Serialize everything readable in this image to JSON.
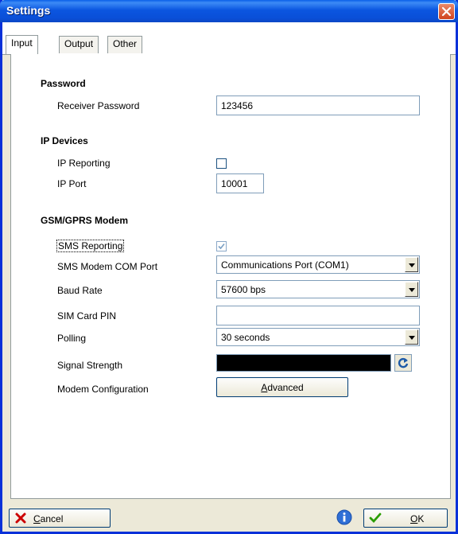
{
  "window": {
    "title": "Settings"
  },
  "tabs": [
    {
      "label": "Input",
      "active": true
    },
    {
      "label": "Output",
      "active": false
    },
    {
      "label": "Other",
      "active": false
    }
  ],
  "password": {
    "section_title": "Password",
    "receiver_password_label": "Receiver Password",
    "receiver_password_value": "123456"
  },
  "ip_devices": {
    "section_title": "IP Devices",
    "ip_reporting_label": "IP Reporting",
    "ip_reporting_checked": false,
    "ip_port_label": "IP Port",
    "ip_port_value": "10001"
  },
  "gsm": {
    "section_title": "GSM/GPRS Modem",
    "sms_reporting_label": "SMS Reporting",
    "sms_reporting_checked": true,
    "com_port_label": "SMS Modem COM Port",
    "com_port_value": "Communications Port (COM1)",
    "baud_rate_label": "Baud Rate",
    "baud_rate_value": "57600 bps",
    "sim_pin_label": "SIM Card PIN",
    "sim_pin_value": "",
    "polling_label": "Polling",
    "polling_value": "30 seconds",
    "signal_strength_label": "Signal Strength",
    "modem_config_label": "Modem Configuration",
    "advanced_button_label": "Advanced"
  },
  "footer": {
    "cancel_label": "Cancel",
    "ok_label": "OK"
  },
  "colors": {
    "title_bar": "#0a4fd8",
    "dialog_face": "#ece9d8",
    "cancel_icon": "#cc0000",
    "ok_icon": "#2a9d00",
    "info_icon": "#2f6fd6"
  },
  "icons": {
    "close": "close-icon",
    "dropdown": "chevron-down-icon",
    "refresh": "refresh-icon",
    "cancel": "x-icon",
    "ok": "check-icon",
    "info": "info-icon"
  }
}
